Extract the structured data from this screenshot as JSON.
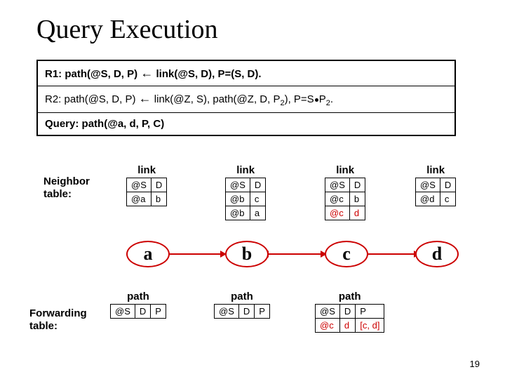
{
  "title": "Query Execution",
  "rules": {
    "r1_label": "R1:",
    "r1_body": "path(@S, D, P)",
    "r1_tail": "link(@S, D), P=(S, D).",
    "r2_label": "R2:",
    "r2_body": "path(@S, D, P)",
    "r2_tail_a": "link(@Z, S), path(@Z, D, P",
    "r2_sub": "2",
    "r2_tail_b": "), P=S",
    "r2_tail_c": "P",
    "r2_tail_d": ".",
    "query_label": "Query:",
    "query_body": "path(@a, d, P, C)"
  },
  "labels": {
    "neighbor1": "Neighbor",
    "neighbor2": "table:",
    "forwarding1": "Forwarding",
    "forwarding2": "table:"
  },
  "link_caption": "link",
  "path_caption": "path",
  "link_headers": [
    "@S",
    "D"
  ],
  "path_headers": [
    "@S",
    "D",
    "P"
  ],
  "link_a": [
    [
      "@a",
      "b"
    ]
  ],
  "link_b": [
    [
      "@b",
      "c"
    ],
    [
      "@b",
      "a"
    ]
  ],
  "link_c": [
    [
      "@c",
      "b"
    ],
    [
      "@c",
      "d"
    ]
  ],
  "link_d": [
    [
      "@d",
      "c"
    ]
  ],
  "link_c_highlight_row": 1,
  "path_c": [
    [
      "@c",
      "d",
      "[c, d]"
    ]
  ],
  "nodes": [
    "a",
    "b",
    "c",
    "d"
  ],
  "slide_number": "19"
}
